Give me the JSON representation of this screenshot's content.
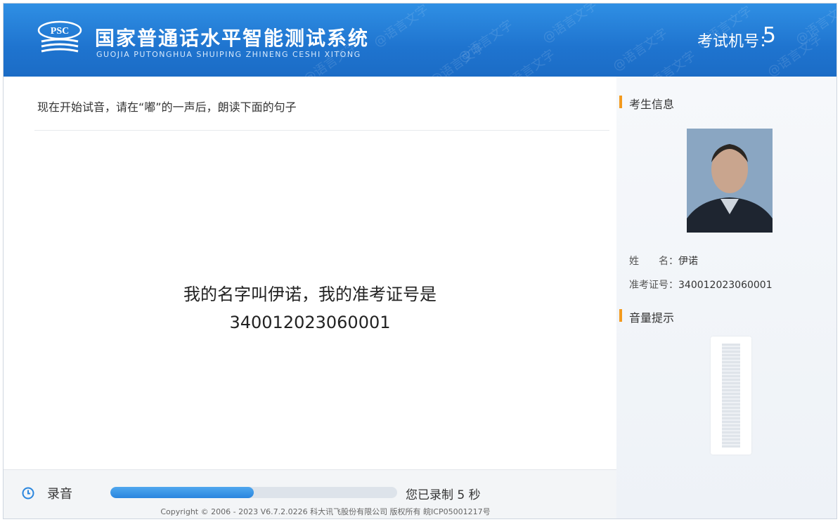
{
  "header": {
    "logo_text": "PSC",
    "title_cn": "国家普通话水平智能测试系统",
    "title_en": "GUOJIA PUTONGHUA SHUIPING ZHINENG CESHI XITONG",
    "machine_label": "考试机号：",
    "machine_number": "5",
    "watermark_text": "@语言文字"
  },
  "main": {
    "instruction": "现在开始试音，请在“嘟”的一声后，朗读下面的句子",
    "sentence_line1": "我的名字叫伊诺，我的准考证号是",
    "sentence_line2": "340012023060001"
  },
  "sidebar": {
    "candidate_section_title": "考生信息",
    "name_label": "姓　　名：",
    "name_value": "伊诺",
    "id_label": "准考证号：",
    "id_value": "340012023060001",
    "volume_section_title": "音量提示",
    "volume_level": 0
  },
  "footer": {
    "record_label": "录音",
    "record_status": "您已录制 5 秒",
    "progress_fraction": 0.5,
    "copyright": "Copyright © 2006 - 2023 V6.7.2.0226 科大讯飞股份有限公司 版权所有 皖ICP05001217号"
  },
  "colors": {
    "header_blue": "#1f74cf",
    "accent_orange": "#f39a1e",
    "progress_blue": "#2a86de"
  },
  "icons": {
    "logo": "psc-logo-icon",
    "record": "clock-icon"
  }
}
